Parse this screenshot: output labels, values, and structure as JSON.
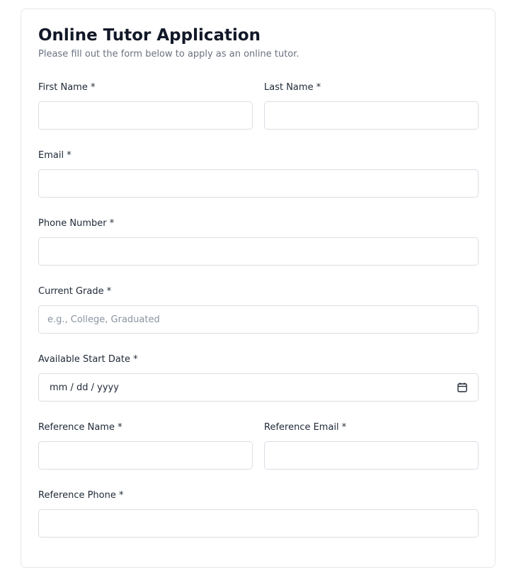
{
  "form": {
    "title": "Online Tutor Application",
    "subtitle": "Please fill out the form below to apply as an online tutor.",
    "fields": {
      "first_name": {
        "label": "First Name *",
        "value": "",
        "placeholder": ""
      },
      "last_name": {
        "label": "Last Name *",
        "value": "",
        "placeholder": ""
      },
      "email": {
        "label": "Email *",
        "value": "",
        "placeholder": ""
      },
      "phone": {
        "label": "Phone Number *",
        "value": "",
        "placeholder": ""
      },
      "current_grade": {
        "label": "Current Grade *",
        "value": "",
        "placeholder": "e.g., College, Graduated"
      },
      "start_date": {
        "label": "Available Start Date *",
        "value": "",
        "display": "mm / dd / yyyy",
        "icon": "calendar-icon"
      },
      "reference_name": {
        "label": "Reference Name *",
        "value": "",
        "placeholder": ""
      },
      "reference_email": {
        "label": "Reference Email *",
        "value": "",
        "placeholder": ""
      },
      "reference_phone": {
        "label": "Reference Phone *",
        "value": "",
        "placeholder": ""
      }
    }
  },
  "colors": {
    "border": "#d9dde3",
    "label": "#1f2937",
    "muted": "#6b7280",
    "placeholder": "#8b93a1"
  }
}
